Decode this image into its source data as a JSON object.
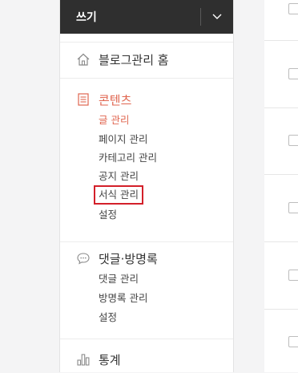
{
  "sidebar": {
    "write_label": "쓰기",
    "home": {
      "label": "블로그관리 홈",
      "icon": "home-icon"
    },
    "contents": {
      "label": "콘텐츠",
      "icon": "document-icon",
      "items": [
        "글 관리",
        "페이지 관리",
        "카테고리 관리",
        "공지 관리",
        "서식 관리",
        "설정"
      ],
      "active_item": "글 관리",
      "highlighted_item": "서식 관리"
    },
    "comments": {
      "label": "댓글·방명록",
      "icon": "speech-bubble-icon",
      "items": [
        "댓글 관리",
        "방명록 관리",
        "설정"
      ]
    },
    "stats": {
      "label": "통계",
      "icon": "bar-chart-icon"
    }
  },
  "colors": {
    "accent": "#e06650",
    "highlight_box": "#d3202a",
    "write_bar": "#2f2f2f"
  }
}
